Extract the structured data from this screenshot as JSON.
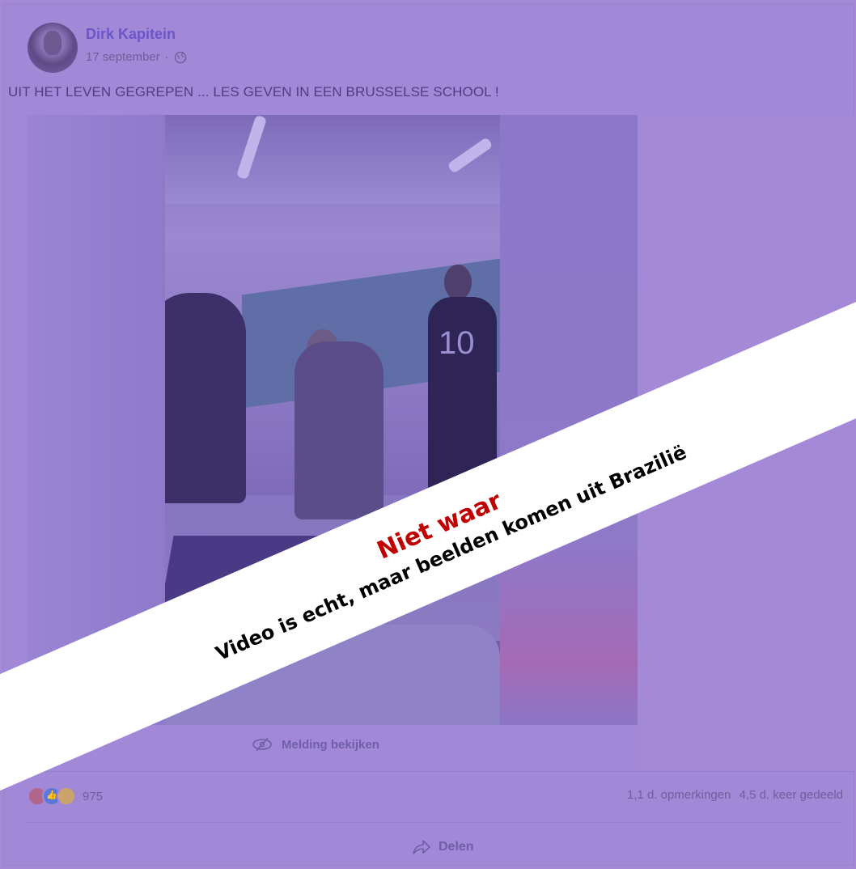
{
  "post": {
    "author": "Dirk Kapitein",
    "date": "17 september",
    "separator": "·",
    "text": "UIT HET LEVEN GEGREPEN ... LES GEVEN IN EEN BRUSSELSE SCHOOL !",
    "video_jersey_number": "10"
  },
  "media": {
    "warning_label": "Melding bekijken"
  },
  "engagement": {
    "reaction_count": "975",
    "comments": "1,1 d. opmerkingen",
    "shares": "4,5 d. keer gedeeld",
    "share_label": "Delen"
  },
  "banner": {
    "verdict": "Niet waar",
    "explanation": "Video is echt, maar beelden komen uit Brazilië"
  },
  "colors": {
    "overlay": "#a48ad6",
    "banner_bg": "#ffffff",
    "verdict": "#c00000",
    "explanation": "#000000"
  }
}
